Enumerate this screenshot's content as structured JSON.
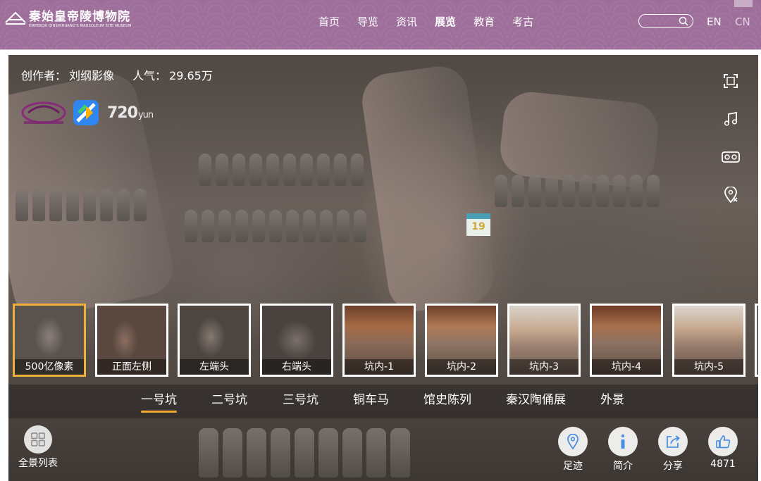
{
  "header": {
    "logo_title": "秦始皇帝陵博物院",
    "logo_subtitle": "EMPEROR QINSHIHUANG'S MAUSOLEUM SITE MUSEUM",
    "nav": [
      {
        "label": "首页"
      },
      {
        "label": "导览"
      },
      {
        "label": "资讯"
      },
      {
        "label": "展览",
        "active": true
      },
      {
        "label": "教育"
      },
      {
        "label": "考古"
      }
    ],
    "search": {
      "placeholder": ""
    },
    "lang_en": "EN",
    "lang_cn": "CN"
  },
  "viewer": {
    "creator_label": "创作者：",
    "creator_name": "刘纲影像",
    "popularity_label": "人气：",
    "popularity_value": "29.65万",
    "brand_720": "720",
    "brand_yun": "yun",
    "sign_number": "19",
    "tools": [
      "fullscreen-icon",
      "music-icon",
      "vr-glasses-icon",
      "location-off-icon"
    ]
  },
  "thumbnails": [
    {
      "label": "500亿像素",
      "selected": true
    },
    {
      "label": "正面左侧"
    },
    {
      "label": "左端头"
    },
    {
      "label": "右端头"
    },
    {
      "label": "坑内-1"
    },
    {
      "label": "坑内-2"
    },
    {
      "label": "坑内-3"
    },
    {
      "label": "坑内-4"
    },
    {
      "label": "坑内-5"
    }
  ],
  "categories": [
    {
      "label": "一号坑",
      "active": true
    },
    {
      "label": "二号坑"
    },
    {
      "label": "三号坑"
    },
    {
      "label": "铜车马"
    },
    {
      "label": "馆史陈列"
    },
    {
      "label": "秦汉陶俑展"
    },
    {
      "label": "外景"
    }
  ],
  "bottom": {
    "panorama_list": "全景列表",
    "footprint": "足迹",
    "intro": "简介",
    "share": "分享",
    "likes": "4871"
  },
  "colors": {
    "header_bg": "#9e6f9b",
    "selected_border": "#f0b03c",
    "active_underline": "#f0a830",
    "icon_blue": "#4a90e2"
  }
}
